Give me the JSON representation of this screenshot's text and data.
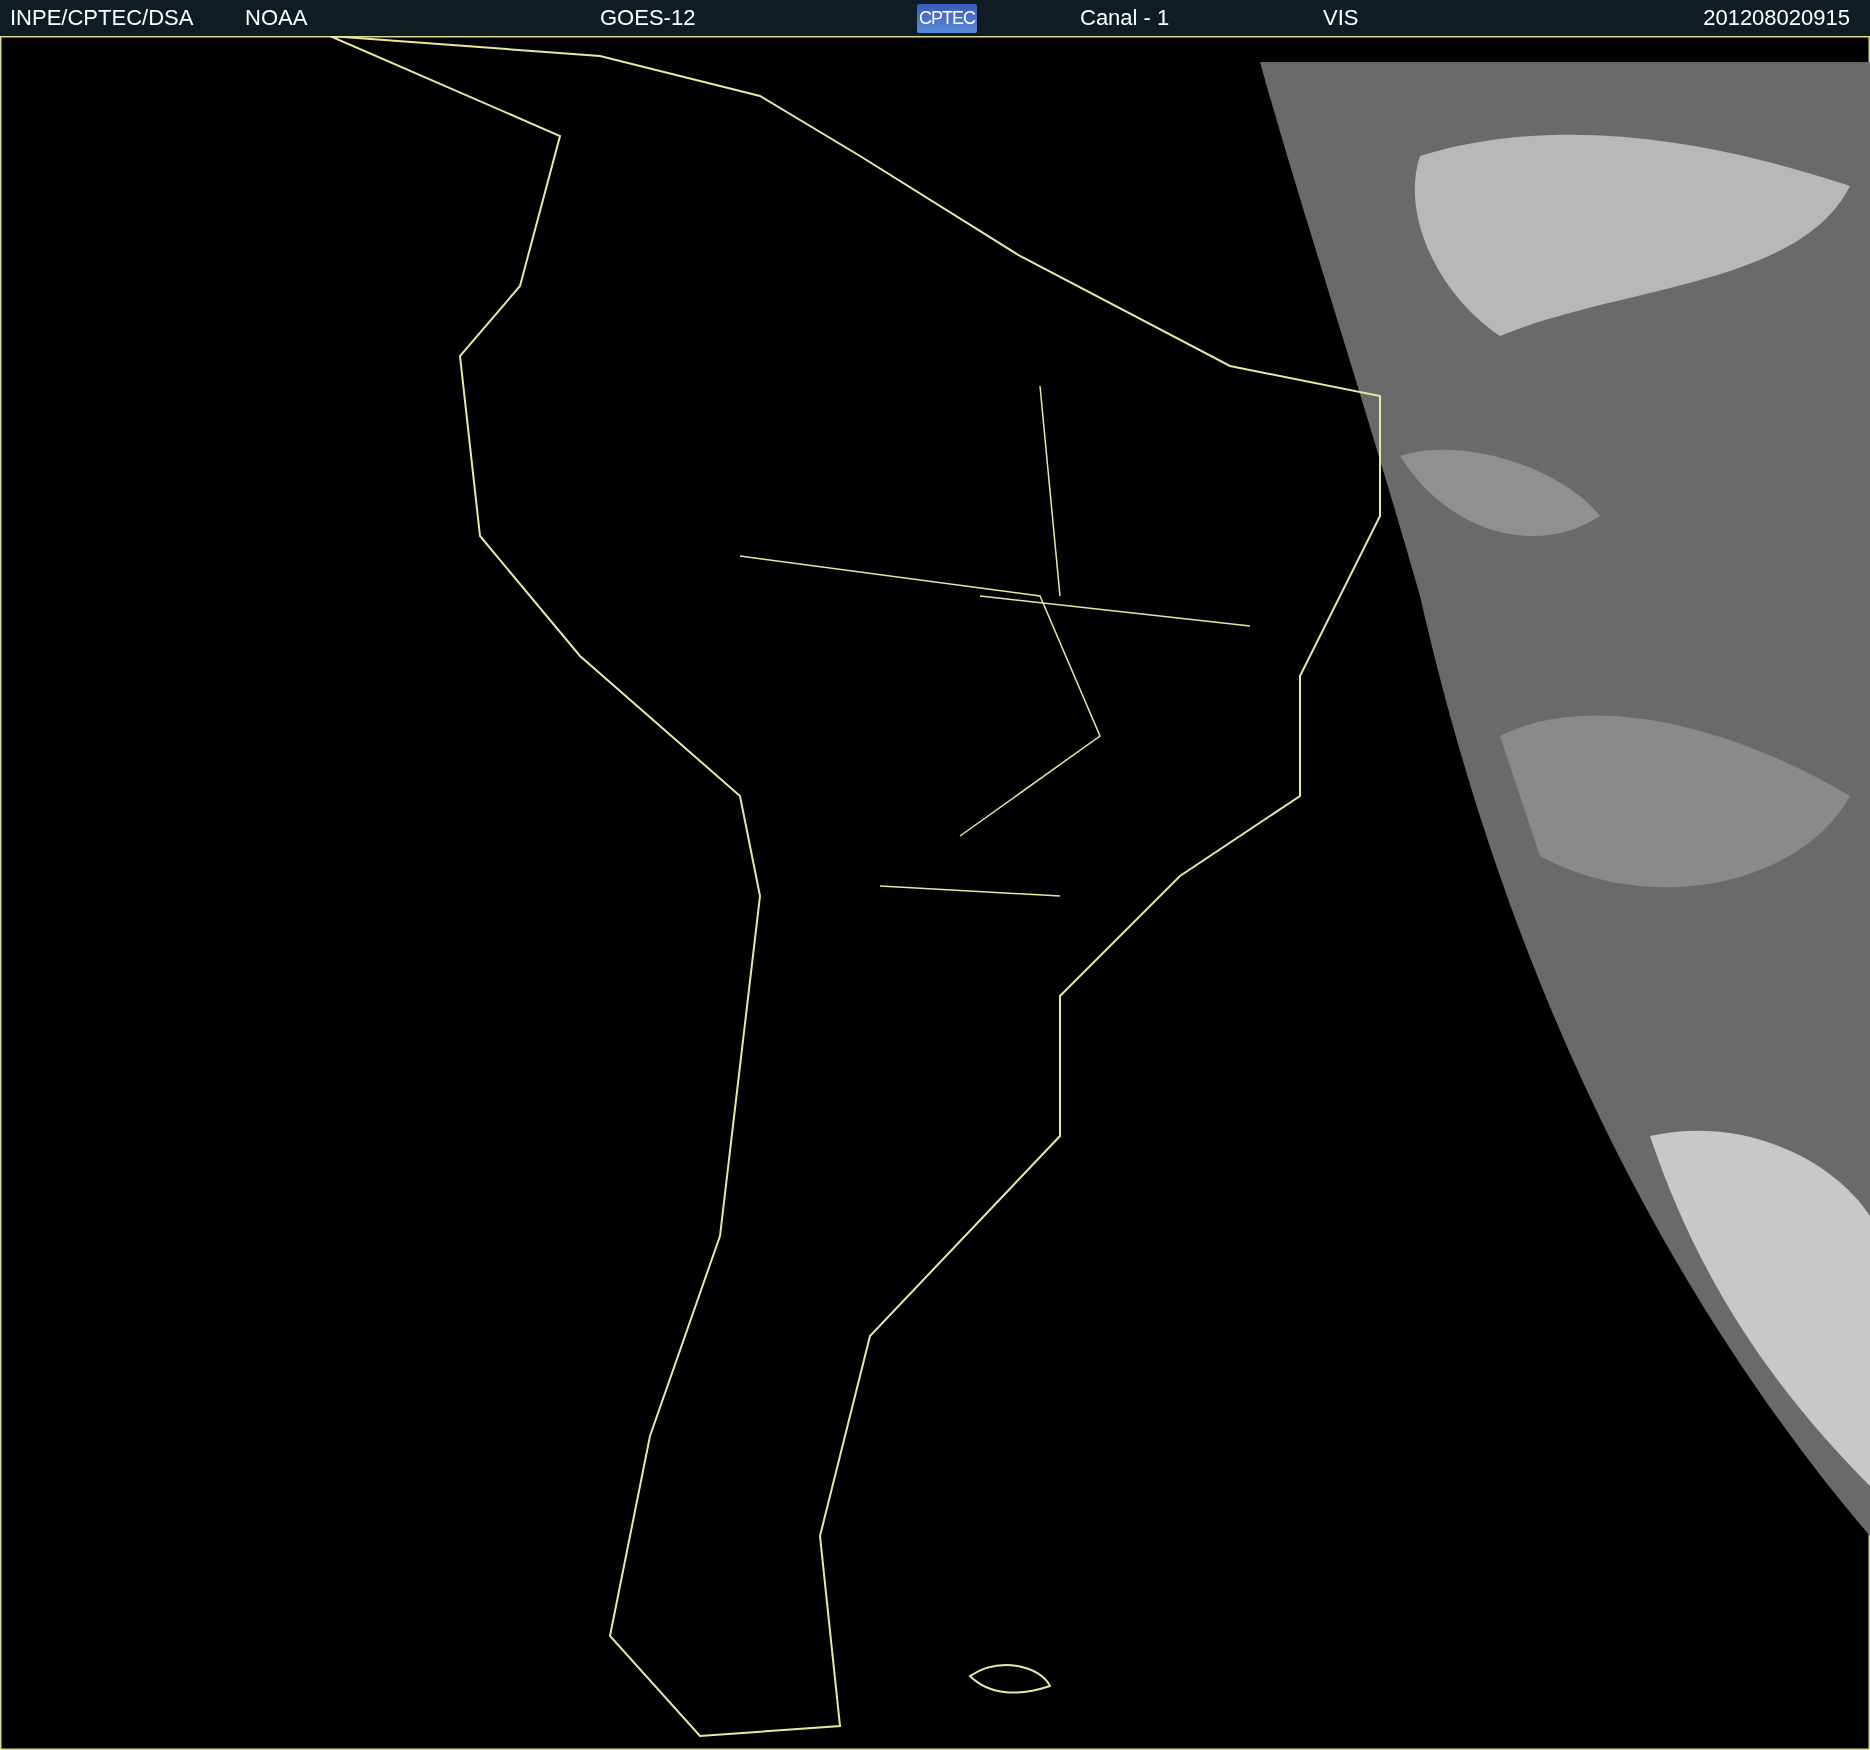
{
  "header": {
    "source": "INPE/CPTEC/DSA",
    "agency": "NOAA",
    "satellite": "GOES-12",
    "logo": "CPTEC",
    "channel": "Canal - 1",
    "band": "VIS",
    "timestamp": "201208020915"
  }
}
